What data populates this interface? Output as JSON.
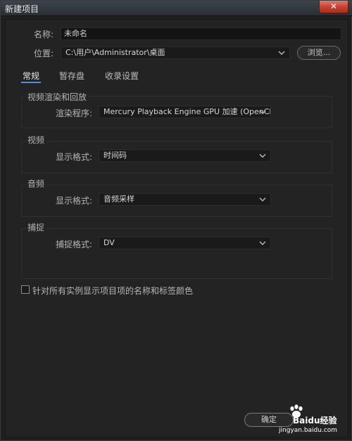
{
  "window": {
    "title": "新建项目",
    "close_label": "✕"
  },
  "name_field": {
    "label": "名称:",
    "value": "未命名"
  },
  "location_field": {
    "label": "位置:",
    "value": "C:\\用户\\Administrator\\桌面",
    "browse_label": "浏览..."
  },
  "tabs": [
    {
      "label": "常规",
      "active": true
    },
    {
      "label": "暂存盘",
      "active": false
    },
    {
      "label": "收录设置",
      "active": false
    }
  ],
  "groups": {
    "render": {
      "title": "视频渲染和回放",
      "label": "渲染程序:",
      "value": "Mercury Playback Engine GPU 加速 (OpenCL)"
    },
    "video": {
      "title": "视频",
      "label": "显示格式:",
      "value": "时间码"
    },
    "audio": {
      "title": "音频",
      "label": "显示格式:",
      "value": "音频采样"
    },
    "capture": {
      "title": "捕捉",
      "label": "捕捉格式:",
      "value": "DV"
    }
  },
  "checkbox_option": {
    "label": "针对所有实例显示项目项的名称和标签颜色",
    "checked": false
  },
  "footer": {
    "ok_label": "确定"
  },
  "watermark": {
    "brand": "Baidu经验",
    "url": "jingyan.baidu.com"
  },
  "colors": {
    "accent": "#4a90e2",
    "background": "#232323",
    "close": "#c2402f"
  }
}
